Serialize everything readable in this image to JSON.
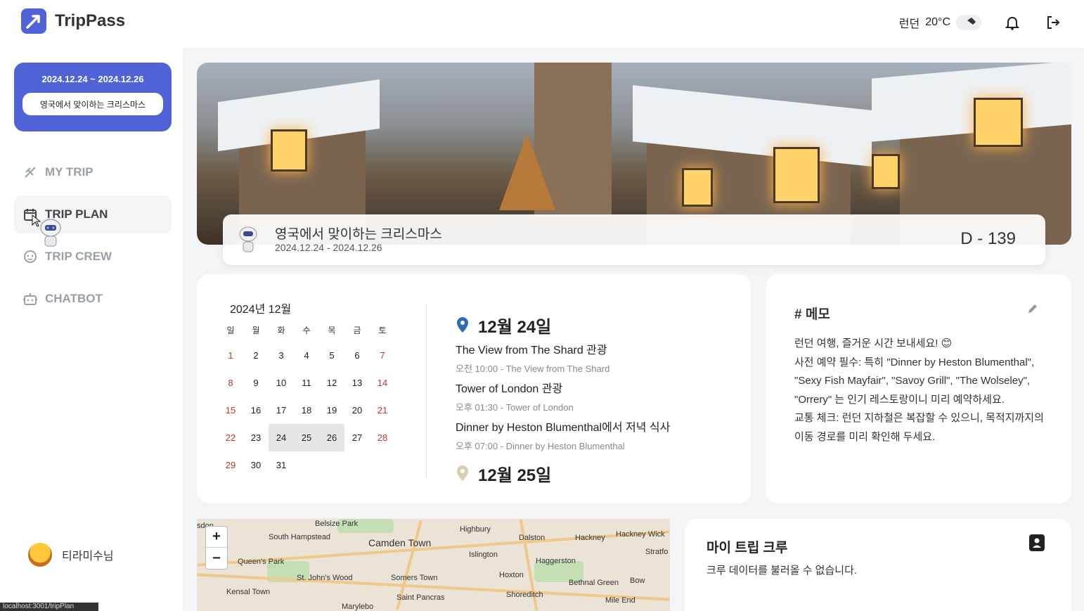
{
  "app": {
    "name": "TripPass"
  },
  "header": {
    "city": "런던",
    "temperature": "20°C",
    "weather_icon": "cloud-icon"
  },
  "trip_card": {
    "dates": "2024.12.24 ~ 2024.12.26",
    "name": "영국에서 맞이하는 크리스마스"
  },
  "nav": {
    "items": [
      {
        "label": "MY TRIP",
        "icon": "plane-icon",
        "active": false
      },
      {
        "label": "TRIP PLAN",
        "icon": "calendar-icon",
        "active": true
      },
      {
        "label": "TRIP CREW",
        "icon": "crew-icon",
        "active": false
      },
      {
        "label": "CHATBOT",
        "icon": "robot-icon",
        "active": false
      }
    ]
  },
  "user": {
    "name": "티라미수님"
  },
  "status_url": "localhost:3001/tripPlan",
  "hero": {
    "title": "영국에서 맞이하는 크리스마스",
    "dates": "2024.12.24 - 2024.12.26",
    "dday": "D - 139"
  },
  "calendar": {
    "title": "2024년 12월",
    "weekdays": [
      "일",
      "월",
      "화",
      "수",
      "목",
      "금",
      "토"
    ],
    "weeks": [
      [
        "1",
        "2",
        "3",
        "4",
        "5",
        "6",
        "7"
      ],
      [
        "8",
        "9",
        "10",
        "11",
        "12",
        "13",
        "14"
      ],
      [
        "15",
        "16",
        "17",
        "18",
        "19",
        "20",
        "21"
      ],
      [
        "22",
        "23",
        "24",
        "25",
        "26",
        "27",
        "28"
      ],
      [
        "29",
        "30",
        "31",
        "",
        "",
        "",
        ""
      ]
    ],
    "selected": [
      "24",
      "25",
      "26"
    ]
  },
  "schedule": {
    "days": [
      {
        "label": "12월 24일",
        "events": [
          {
            "title": "The View from The Shard 관광",
            "sub": "오전 10:00 - The View from The Shard"
          },
          {
            "title": "Tower of London 관광",
            "sub": "오후 01:30 - Tower of London"
          },
          {
            "title": "Dinner by Heston Blumenthal에서 저녁 식사",
            "sub": "오후 07:00 - Dinner by Heston Blumenthal"
          }
        ]
      },
      {
        "label": "12월 25일",
        "events": []
      }
    ]
  },
  "memo": {
    "title": "# 메모",
    "lines": [
      "런던 여행, 즐거운 시간 보내세요! 😊",
      "사전 예약 필수: 특히 \"Dinner by Heston Blumenthal\", \"Sexy Fish Mayfair\", \"Savoy Grill\", \"The Wolseley\", \"Orrery\" 는 인기 레스토랑이니 미리 예약하세요.",
      "교통 체크: 런던 지하철은 복잡할 수 있으니, 목적지까지의 이동 경로를 미리 확인해 두세요."
    ]
  },
  "map": {
    "zoom_in": "+",
    "zoom_out": "−",
    "labels": [
      "sdon",
      "Belsize Park",
      "South Hampstead",
      "Camden Town",
      "Highbury",
      "Dalston",
      "Hackney",
      "Hackney Wick",
      "Queen's Park",
      "Islington",
      "Haggerston",
      "Stratfo",
      "St. John's Wood",
      "Somers Town",
      "Hoxton",
      "Bethnal Green",
      "Bow",
      "Kensal Town",
      "Saint Pancras",
      "Shoreditch",
      "Mile End",
      "Marylebo"
    ]
  },
  "crew": {
    "title": "마이 트립 크루",
    "empty": "크루 데이터를 불러올 수 없습니다."
  },
  "colors": {
    "accent": "#4f63d6",
    "weekend": "#c0392b",
    "background": "#f3f4f6"
  }
}
